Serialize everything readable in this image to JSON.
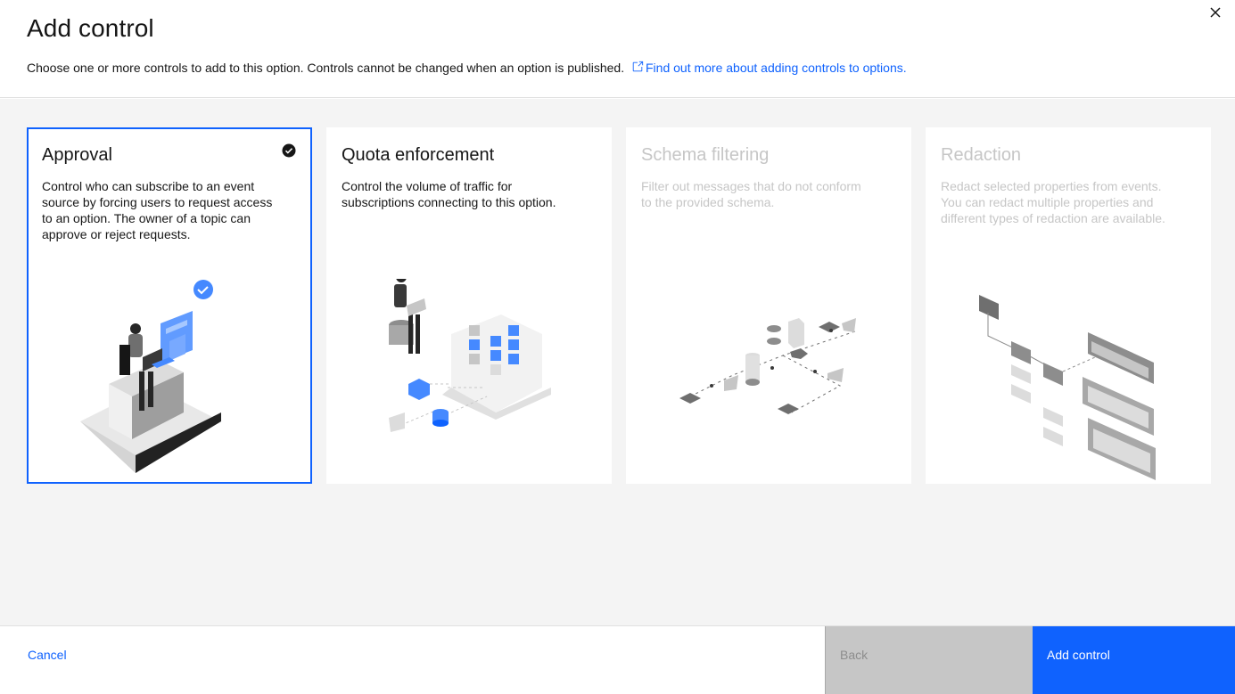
{
  "header": {
    "title": "Add control",
    "description": "Choose one or more controls to add to this option. Controls cannot be changed when an option is published.",
    "link_text": "Find out more about adding controls to options.",
    "close_icon": "close-icon"
  },
  "cards": [
    {
      "title": "Approval",
      "description": "Control who can subscribe to an event source by forcing users to request access to an option. The owner of a topic can approve or reject requests.",
      "state": "selected"
    },
    {
      "title": "Quota enforcement",
      "description": "Control the volume of traffic for subscriptions connecting to this option.",
      "state": "enabled"
    },
    {
      "title": "Schema filtering",
      "description": "Filter out messages that do not conform to the provided schema.",
      "state": "disabled"
    },
    {
      "title": "Redaction",
      "description": "Redact selected properties from events. You can redact multiple properties and different types of redaction are available.",
      "state": "disabled"
    }
  ],
  "footer": {
    "cancel_label": "Cancel",
    "back_label": "Back",
    "add_label": "Add control"
  },
  "colors": {
    "accent": "#0f62fe",
    "disabled_text": "#c6c6c6",
    "content_bg": "#f4f4f4"
  }
}
